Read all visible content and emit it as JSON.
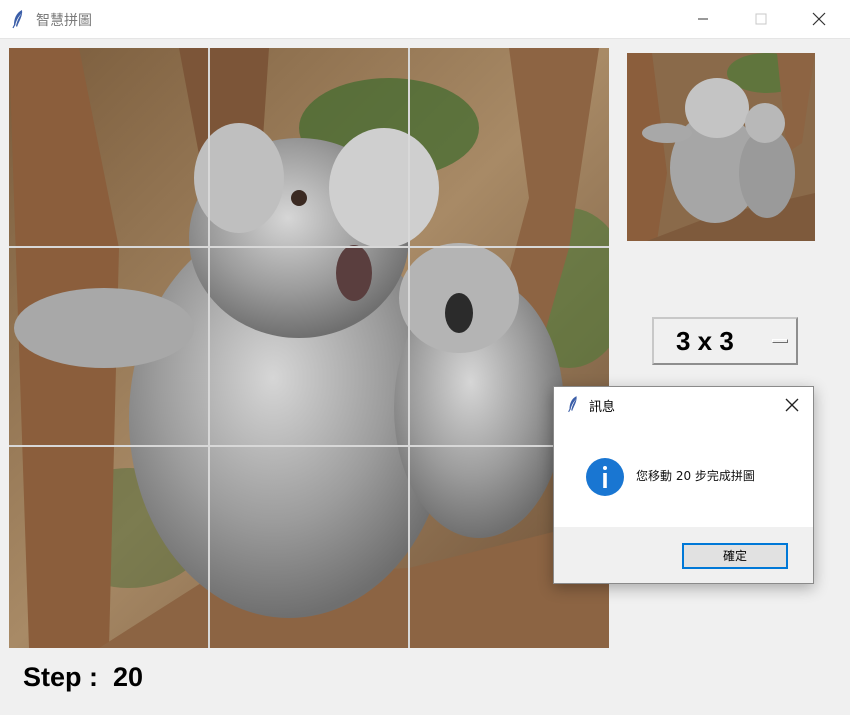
{
  "window": {
    "title": "智慧拼圖",
    "icon": "feather-icon",
    "controls": [
      "minimize-icon",
      "maximize-icon",
      "close-icon"
    ]
  },
  "puzzle": {
    "grid": "3 x 3",
    "grid_lines_color": "#d8d8d8"
  },
  "size_selector": {
    "value": "3 x 3"
  },
  "status": {
    "step_text": "Step :  20"
  },
  "dialog": {
    "title": "訊息",
    "icon": "info-icon",
    "message": "您移動 20 步完成拼圖",
    "ok_label": "確定",
    "accent": "#0078d7"
  }
}
